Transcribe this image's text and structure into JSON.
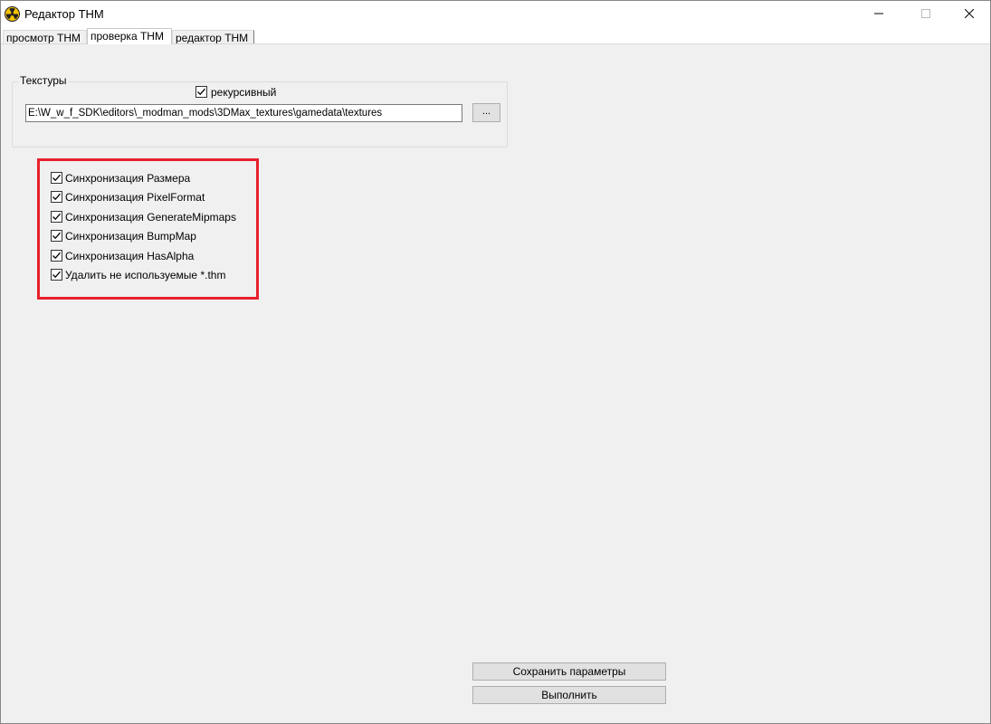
{
  "window": {
    "title": "Редактор THM"
  },
  "tabs": [
    {
      "label": "просмотр THM"
    },
    {
      "label": "проверка THM"
    },
    {
      "label": "редактор THM"
    }
  ],
  "textures_group": {
    "legend": "Текстуры",
    "recursive_label": "рекурсивный",
    "recursive_checked": true,
    "path_value": "E:\\W_w_f_SDK\\editors\\_modman_mods\\3DMax_textures\\gamedata\\textures",
    "browse_label": "..."
  },
  "options": [
    {
      "label": "Синхронизация Размера",
      "checked": true
    },
    {
      "label": "Синхронизация PixelFormat",
      "checked": true
    },
    {
      "label": "Синхронизация GenerateMipmaps",
      "checked": true
    },
    {
      "label": "Синхронизация BumpMap",
      "checked": true
    },
    {
      "label": "Синхронизация HasAlpha",
      "checked": true
    },
    {
      "label": "Удалить не используемые *.thm",
      "checked": true
    }
  ],
  "buttons": {
    "save_label": "Сохранить параметры",
    "run_label": "Выполнить"
  },
  "colors": {
    "highlight": "#e8202c",
    "app_icon": "#f5c400"
  },
  "icons": {
    "app": "radiation-icon",
    "minimize": "minimize-icon",
    "maximize": "maximize-icon",
    "close": "close-icon"
  }
}
